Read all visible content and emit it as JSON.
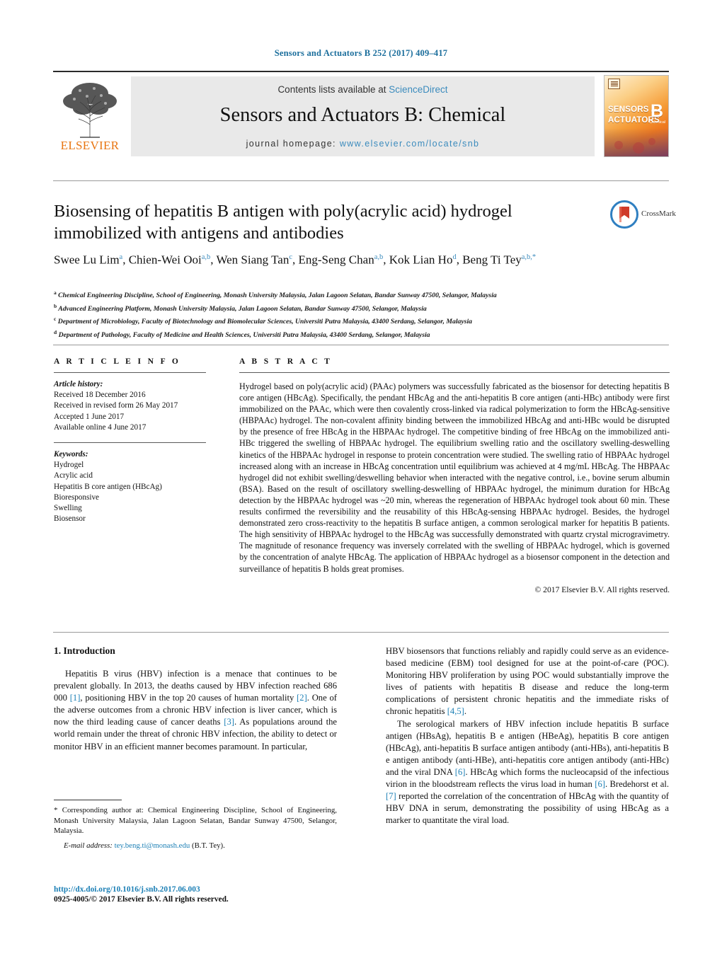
{
  "running_head": "Sensors and Actuators B 252 (2017) 409–417",
  "banner": {
    "contents_prefix": "Contents lists available at ",
    "sciencedirect": "ScienceDirect",
    "journal_title": "Sensors and Actuators B: Chemical",
    "homepage_prefix": "journal homepage: ",
    "homepage_url": "www.elsevier.com/locate/snb",
    "publisher": "ELSEVIER",
    "cover_line1": "SENSORS",
    "cover_and": "and",
    "cover_line2": "ACTUATORS",
    "cover_letter": "B",
    "cover_sub": "Chemical",
    "link_color": "#3b8bbd"
  },
  "article": {
    "title": "Biosensing of hepatitis B antigen with poly(acrylic acid) hydrogel immobilized with antigens and antibodies",
    "crossmark_label": "CrossMark",
    "authors_html": "Swee Lu Lim<sup>a</sup>, Chien-Wei Ooi<sup>a,b</sup>, Wen Siang Tan<sup>c</sup>, Eng-Seng Chan<sup>a,b</sup>, Kok Lian Ho<sup>d</sup>, Beng Ti Tey<sup>a,b,</sup><sup>*</sup>",
    "affiliations": [
      {
        "marker": "a",
        "text": "Chemical Engineering Discipline, School of Engineering, Monash University Malaysia, Jalan Lagoon Selatan, Bandar Sunway 47500, Selangor, Malaysia"
      },
      {
        "marker": "b",
        "text": "Advanced Engineering Platform, Monash University Malaysia, Jalan Lagoon Selatan, Bandar Sunway 47500, Selangor, Malaysia"
      },
      {
        "marker": "c",
        "text": "Department of Microbiology, Faculty of Biotechnology and Biomolecular Sciences, Universiti Putra Malaysia, 43400 Serdang, Selangor, Malaysia"
      },
      {
        "marker": "d",
        "text": "Department of Pathology, Faculty of Medicine and Health Sciences, Universiti Putra Malaysia, 43400 Serdang, Selangor, Malaysia"
      }
    ]
  },
  "article_info": {
    "heading": "A R T I C L E   I N F O",
    "history_label": "Article history:",
    "history": [
      "Received 18 December 2016",
      "Received in revised form 26 May 2017",
      "Accepted 1 June 2017",
      "Available online 4 June 2017"
    ],
    "keywords_label": "Keywords:",
    "keywords": [
      "Hydrogel",
      "Acrylic acid",
      "Hepatitis B core antigen (HBcAg)",
      "Bioresponsive",
      "Swelling",
      "Biosensor"
    ]
  },
  "abstract": {
    "heading": "A B S T R A C T",
    "text": "Hydrogel based on poly(acrylic acid) (PAAc) polymers was successfully fabricated as the biosensor for detecting hepatitis B core antigen (HBcAg). Specifically, the pendant HBcAg and the anti-hepatitis B core antigen (anti-HBc) antibody were first immobilized on the PAAc, which were then covalently cross-linked via radical polymerization to form the HBcAg-sensitive (HBPAAc) hydrogel. The non-covalent affinity binding between the immobilized HBcAg and anti-HBc would be disrupted by the presence of free HBcAg in the HBPAAc hydrogel. The competitive binding of free HBcAg on the immobilized anti-HBc triggered the swelling of HBPAAc hydrogel. The equilibrium swelling ratio and the oscillatory swelling-deswelling kinetics of the HBPAAc hydrogel in response to protein concentration were studied. The swelling ratio of HBPAAc hydrogel increased along with an increase in HBcAg concentration until equilibrium was achieved at 4 mg/mL HBcAg. The HBPAAc hydrogel did not exhibit swelling/deswelling behavior when interacted with the negative control, i.e., bovine serum albumin (BSA). Based on the result of oscillatory swelling-deswelling of HBPAAc hydrogel, the minimum duration for HBcAg detection by the HBPAAc hydrogel was ~20 min, whereas the regeneration of HBPAAc hydrogel took about 60 min. These results confirmed the reversibility and the reusability of this HBcAg-sensing HBPAAc hydrogel. Besides, the hydrogel demonstrated zero cross-reactivity to the hepatitis B surface antigen, a common serological marker for hepatitis B patients. The high sensitivity of HBPAAc hydrogel to the HBcAg was successfully demonstrated with quartz crystal microgravimetry. The magnitude of resonance frequency was inversely correlated with the swelling of HBPAAc hydrogel, which is governed by the concentration of analyte HBcAg. The application of HBPAAc hydrogel as a biosensor component in the detection and surveillance of hepatitis B holds great promises.",
    "copyright": "© 2017 Elsevier B.V. All rights reserved."
  },
  "introduction": {
    "heading": "1.  Introduction",
    "left_para_1_part1": "Hepatitis B virus (HBV) infection is a menace that continues to be prevalent globally. In 2013, the deaths caused by HBV infection reached 686 000 ",
    "ref1": "[1]",
    "left_para_1_part2": ", positioning HBV in the top 20 causes of human mortality ",
    "ref2": "[2]",
    "left_para_1_part3": ". One of the adverse outcomes from a chronic HBV infection is liver cancer, which is now the third leading cause of cancer deaths ",
    "ref3": "[3]",
    "left_para_1_part4": ". As populations around the world remain under the threat of chronic HBV infection, the ability to detect or monitor HBV in an efficient manner becomes paramount. In particular,",
    "right_para_1_part1": "HBV biosensors that functions reliably and rapidly could serve as an evidence-based medicine (EBM) tool designed for use at the point-of-care (POC). Monitoring HBV proliferation by using POC would substantially improve the lives of patients with hepatitis B disease and reduce the long-term complications of persistent chronic hepatitis and the immediate risks of chronic hepatitis ",
    "ref45": "[4,5]",
    "right_para_1_part2": ".",
    "right_para_2_part1": "The serological markers of HBV infection include hepatitis B surface antigen (HBsAg), hepatitis B e antigen (HBeAg), hepatitis B core antigen (HBcAg), anti-hepatitis B surface antigen antibody (anti-HBs), anti-hepatitis B e antigen antibody (anti-HBe), anti-hepatitis core antigen antibody (anti-HBc) and the viral DNA ",
    "ref6a": "[6]",
    "right_para_2_part2": ". HBcAg which forms the nucleocapsid of the infectious virion in the bloodstream reflects the virus load in human ",
    "ref6b": "[6]",
    "right_para_2_part3": ". Bredehorst et al. ",
    "ref7": "[7]",
    "right_para_2_part4": " reported the correlation of the concentration of HBcAg with the quantity of HBV DNA in serum, demonstrating the possibility of using HBcAg as a marker to quantitate the viral load."
  },
  "footnote": {
    "star": "*",
    "corresponding": " Corresponding author at: Chemical Engineering Discipline, School of Engineering, Monash University Malaysia, Jalan Lagoon Selatan, Bandar Sunway 47500, Selangor, Malaysia.",
    "email_label": "E-mail address:",
    "email": "tey.beng.ti@monash.edu",
    "email_suffix": " (B.T. Tey)."
  },
  "footer": {
    "doi": "http://dx.doi.org/10.1016/j.snb.2017.06.003",
    "issn_line": "0925-4005/© 2017 Elsevier B.V. All rights reserved."
  }
}
